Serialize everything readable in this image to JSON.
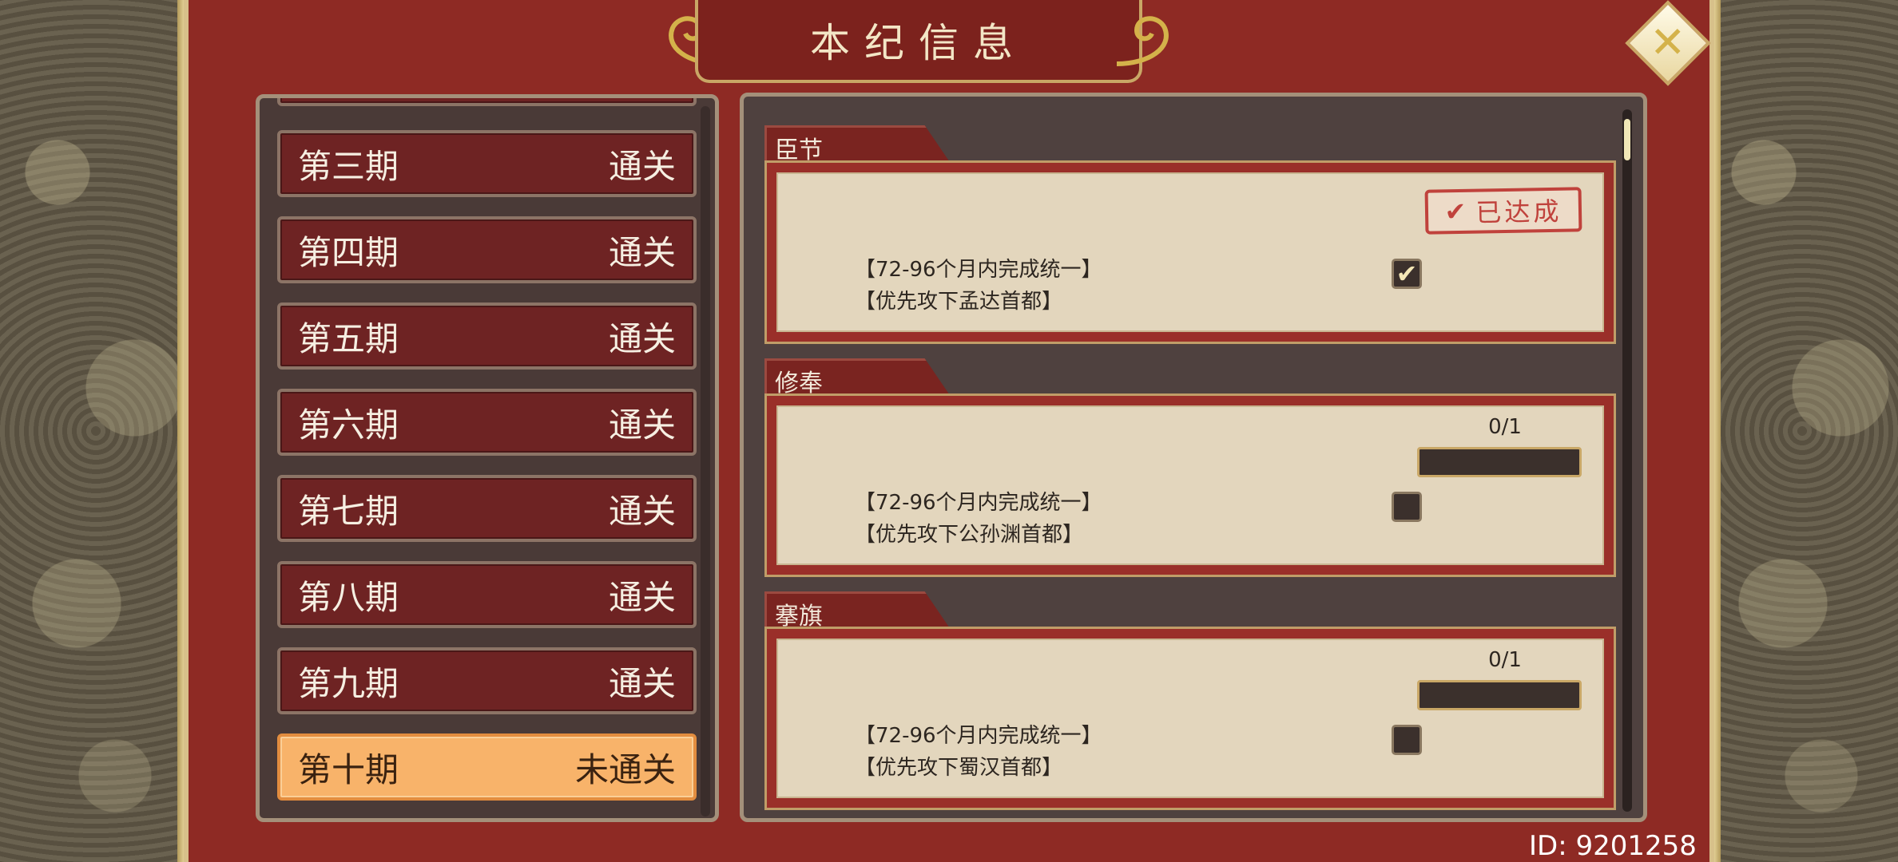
{
  "title": "本纪信息",
  "close_icon": "close-x-icon",
  "periods": [
    {
      "label": "第三期",
      "status": "通关",
      "active": false
    },
    {
      "label": "第四期",
      "status": "通关",
      "active": false
    },
    {
      "label": "第五期",
      "status": "通关",
      "active": false
    },
    {
      "label": "第六期",
      "status": "通关",
      "active": false
    },
    {
      "label": "第七期",
      "status": "通关",
      "active": false
    },
    {
      "label": "第八期",
      "status": "通关",
      "active": false
    },
    {
      "label": "第九期",
      "status": "通关",
      "active": false
    },
    {
      "label": "第十期",
      "status": "未通关",
      "active": true
    }
  ],
  "sections": [
    {
      "tab": "臣节",
      "line1": "【72-96个月内完成统一】",
      "line2": "【优先攻下孟达首都】",
      "checked": true,
      "stamp": "已达成"
    },
    {
      "tab": "修奉",
      "line1": "【72-96个月内完成统一】",
      "line2": "【优先攻下公孙渊首都】",
      "checked": false,
      "progress_text": "0/1",
      "progress": 0
    },
    {
      "tab": "搴旗",
      "line1": "【72-96个月内完成统一】",
      "line2": "【优先攻下蜀汉首都】",
      "checked": false,
      "progress_text": "0/1",
      "progress": 0
    }
  ],
  "id_text": "ID:  9201258",
  "colors": {
    "frame_red": "#8e2a24",
    "item_red": "#6e2323",
    "active_orange": "#f8b36a",
    "stamp_red": "#c0423c"
  }
}
